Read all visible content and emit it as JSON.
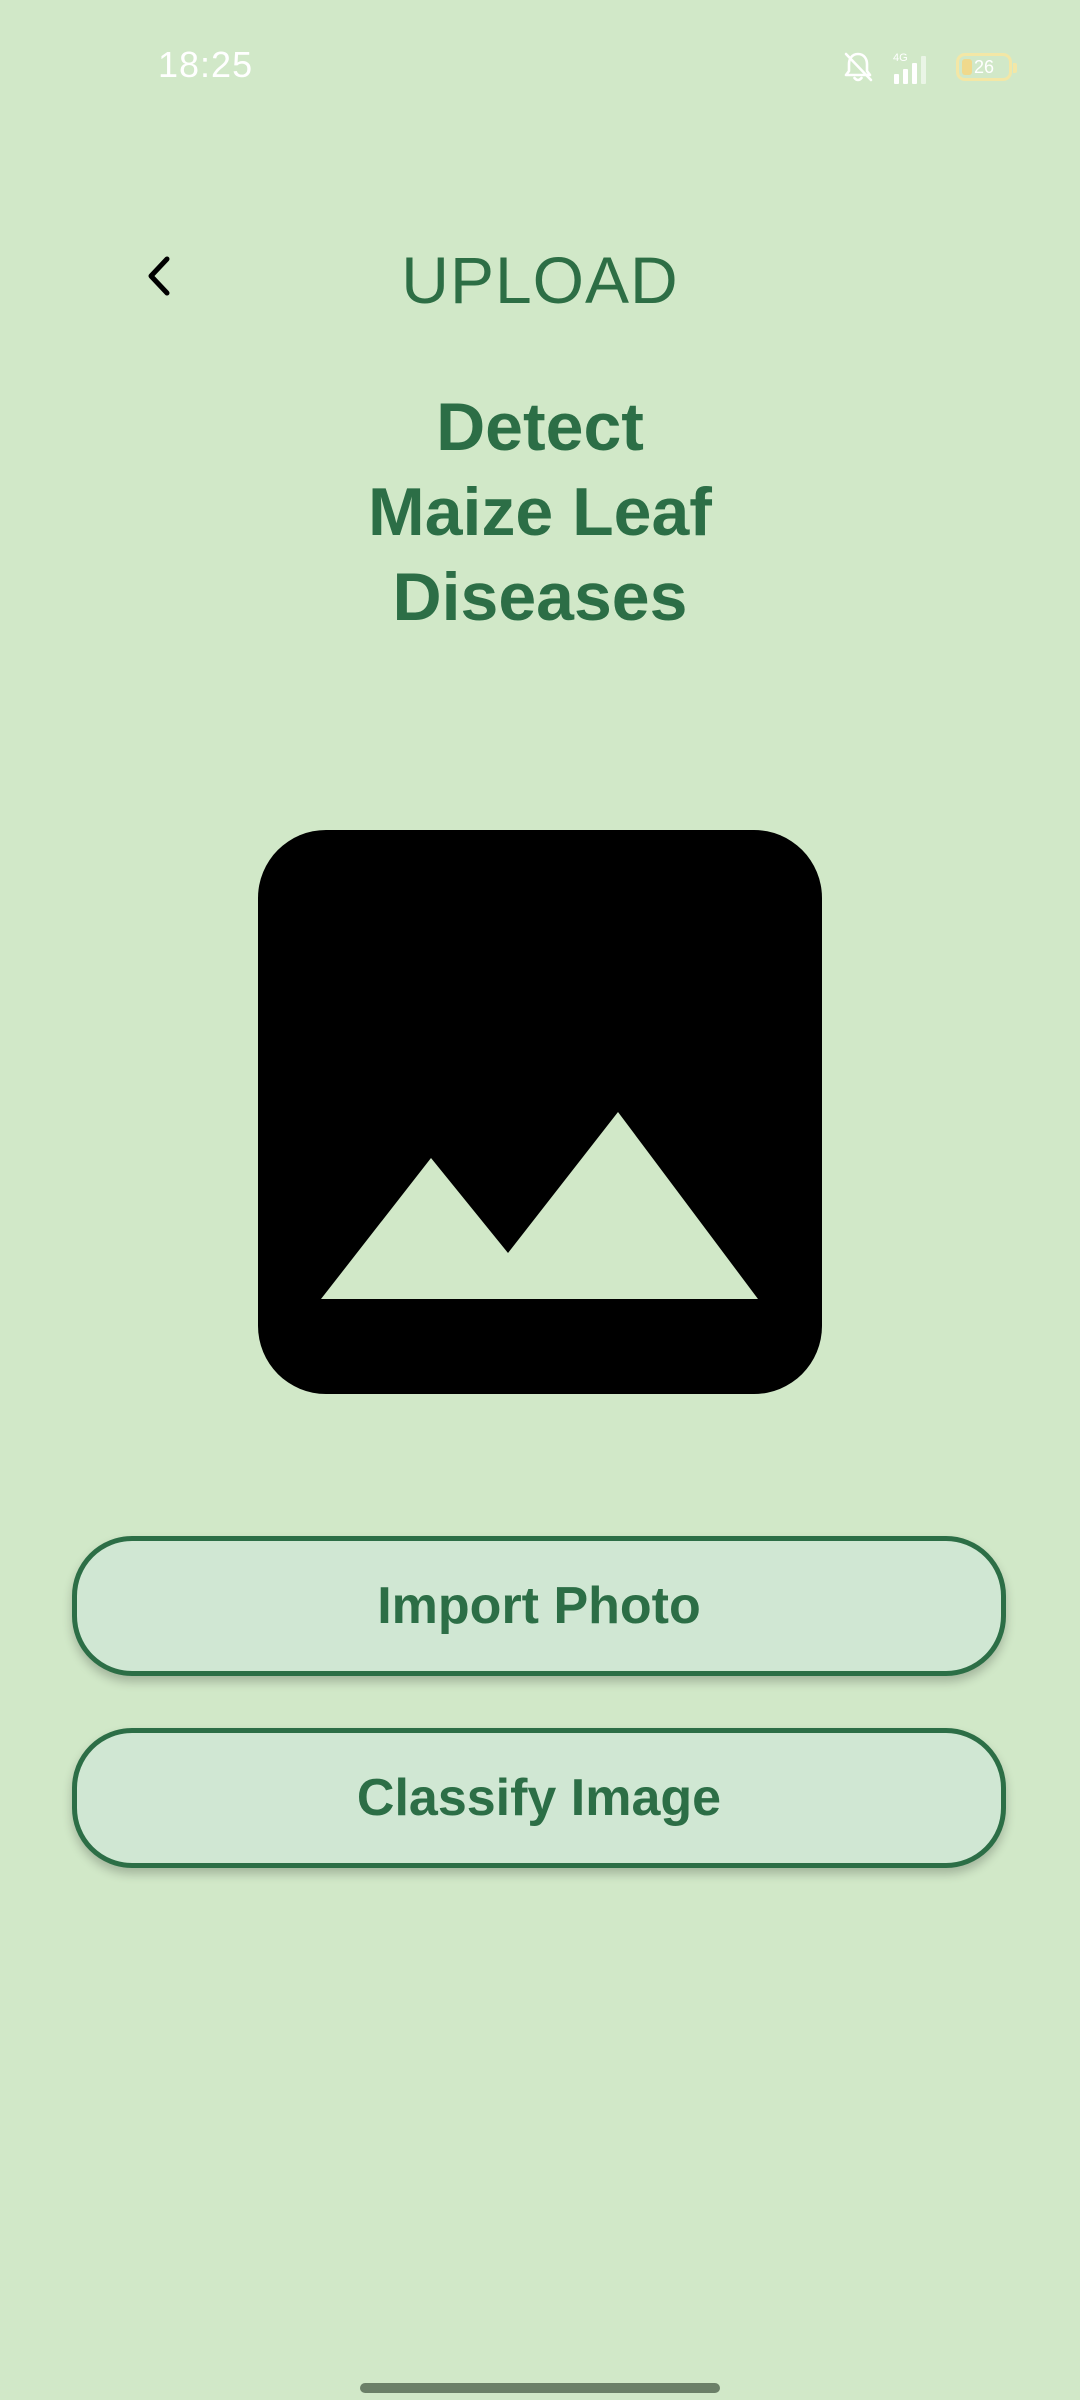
{
  "status_bar": {
    "time": "18:25",
    "network": "4G",
    "battery_level": "26",
    "icons": [
      "bell-off-icon",
      "signal-icon",
      "battery-icon"
    ]
  },
  "header": {
    "back_icon": "chevron-left-icon",
    "title": "UPLOAD"
  },
  "headline": {
    "line1": "Detect",
    "line2": "Maize Leaf",
    "line3": "Diseases"
  },
  "image_placeholder": {
    "icon": "image-icon"
  },
  "buttons": {
    "import_label": "Import Photo",
    "classify_label": "Classify Image"
  },
  "colors": {
    "background": "#d1e8c8",
    "accent": "#2c6e46",
    "button_fill": "#d0e7d3"
  }
}
